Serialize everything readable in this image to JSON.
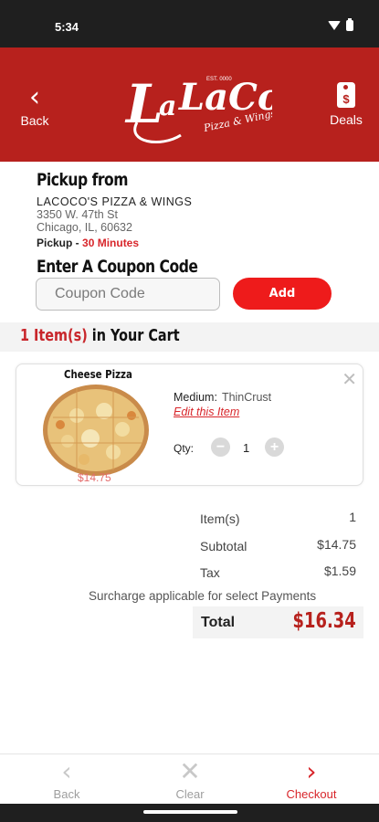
{
  "status_bar": {
    "time": "5:34",
    "wifi_icon": "wifi-icon",
    "battery_icon": "battery-icon"
  },
  "header": {
    "back_label": "Back",
    "deals_label": "Deals",
    "deals_icon_symbol": "$",
    "logo_text": "LaCoco's",
    "logo_subtext": "Pizza & Wings",
    "logo_est": "EST. 0000",
    "brand_color": "#b7211d"
  },
  "pickup": {
    "title": "Pickup from",
    "store_name": "LACOCO'S PIZZA & WINGS",
    "address_line1": "3350 W. 47th St",
    "address_line2": "Chicago, IL, 60632",
    "pickup_label": "Pickup - ",
    "pickup_time": "30 Minutes"
  },
  "coupon": {
    "title": "Enter A Coupon Code",
    "placeholder": "Coupon Code",
    "add_label": "Add"
  },
  "cart": {
    "count": "1 Item(s)",
    "heading_rest": " in Your Cart",
    "items": [
      {
        "name": "Cheese Pizza",
        "price": "$14.75",
        "option_label": "Medium:",
        "option_value": "ThinCrust",
        "edit_label": "Edit this Item",
        "qty_label": "Qty:",
        "qty": "1",
        "minus": "−",
        "plus": "+"
      }
    ]
  },
  "summary": {
    "items_label": "Item(s)",
    "items_value": "1",
    "subtotal_label": "Subtotal",
    "subtotal_value": "$14.75",
    "tax_label": "Tax",
    "tax_value": "$1.59",
    "surcharge_note": "Surcharge applicable for select Payments",
    "total_label": "Total",
    "total_value": "$16.34"
  },
  "bottom_nav": {
    "back_label": "Back",
    "clear_label": "Clear",
    "checkout_label": "Checkout"
  },
  "colors": {
    "accent_red": "#ee1b1b",
    "text_red": "#d8262b",
    "muted": "#9e9e9e"
  }
}
